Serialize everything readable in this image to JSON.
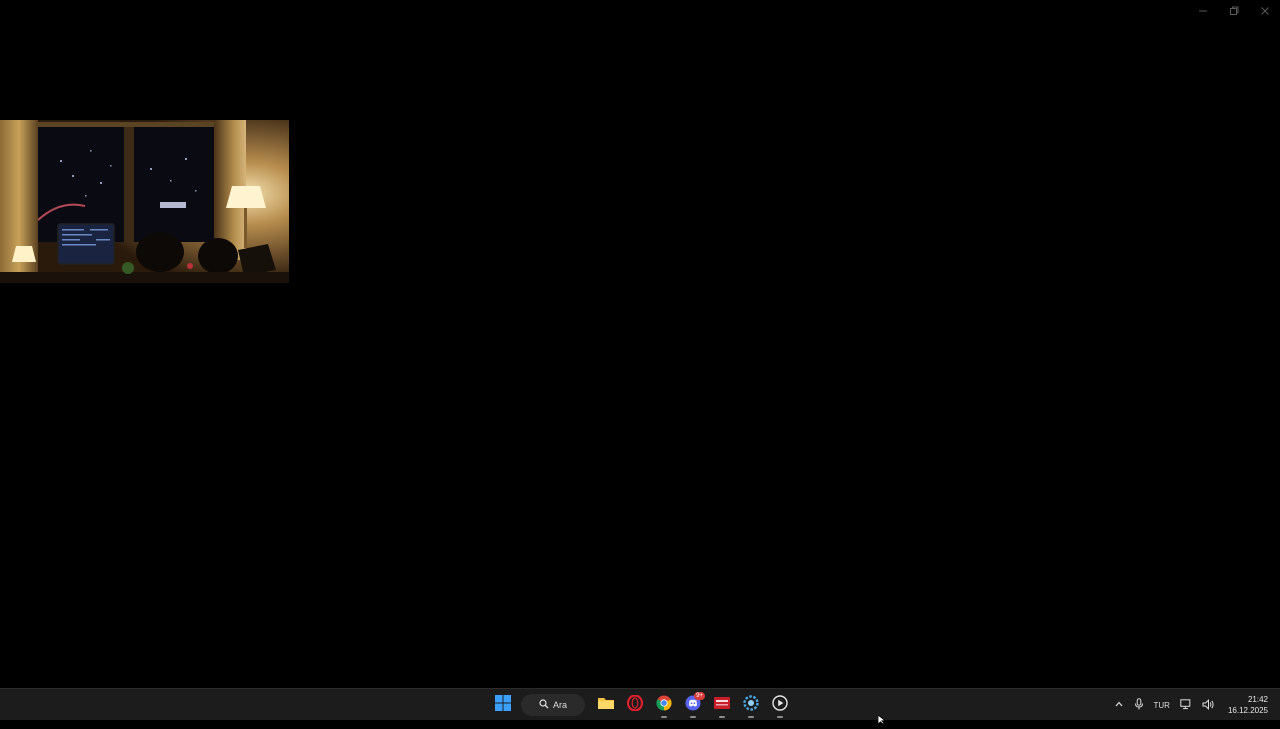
{
  "window": {
    "caption": {
      "minimize_icon": "minimize-icon",
      "restore_icon": "restore-icon",
      "close_icon": "close-icon"
    }
  },
  "desktop": {
    "photo": {
      "subject": "night room with window city view, lamps, monitor"
    }
  },
  "taskbar": {
    "start_icon": "windows-start-icon",
    "search": {
      "label": "Ara",
      "icon": "search-icon"
    },
    "apps": [
      {
        "name": "file-explorer",
        "icon": "folder-icon",
        "running": false
      },
      {
        "name": "opera",
        "icon": "opera-icon",
        "running": false
      },
      {
        "name": "chrome",
        "icon": "chrome-icon",
        "running": true
      },
      {
        "name": "discord",
        "icon": "discord-icon",
        "running": true,
        "badge": "9+"
      },
      {
        "name": "recording-app",
        "icon": "red-app-icon",
        "running": true
      },
      {
        "name": "settings-app",
        "icon": "blue-gear-app-icon",
        "running": true
      },
      {
        "name": "media-player",
        "icon": "play-icon",
        "running": true
      }
    ],
    "tray": {
      "chevron_icon": "chevron-up-icon",
      "mic_icon": "microphone-icon",
      "language": "TUR",
      "network_icon": "network-icon",
      "volume_icon": "volume-icon",
      "time": "21:42",
      "date": "16.12.2025"
    }
  },
  "colors": {
    "taskbar_bg": "#1c1c1c",
    "desktop_bg": "#000000",
    "accent_blue": "#3ba0ff"
  }
}
